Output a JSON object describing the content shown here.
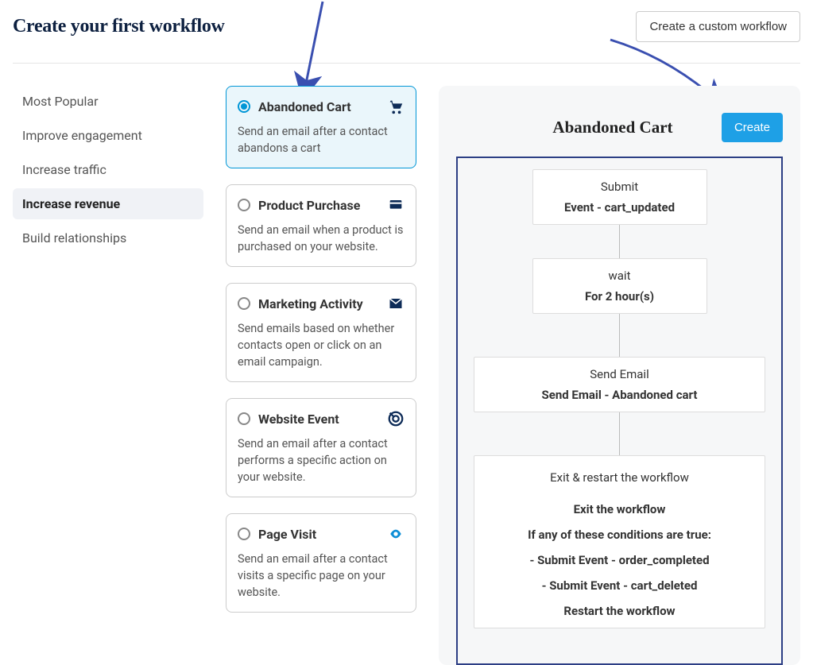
{
  "header": {
    "title": "Create your first workflow",
    "custom_button": "Create a custom workflow"
  },
  "sidebar": {
    "items": [
      {
        "label": "Most Popular",
        "active": false
      },
      {
        "label": "Improve engagement",
        "active": false
      },
      {
        "label": "Increase traffic",
        "active": false
      },
      {
        "label": "Increase revenue",
        "active": true
      },
      {
        "label": "Build relationships",
        "active": false
      }
    ]
  },
  "options": [
    {
      "title": "Abandoned Cart",
      "desc": "Send an email after a contact abandons a cart",
      "icon": "cart-icon",
      "selected": true
    },
    {
      "title": "Product Purchase",
      "desc": "Send an email when a product is purchased on your website.",
      "icon": "card-icon",
      "selected": false
    },
    {
      "title": "Marketing Activity",
      "desc": "Send emails based on whether contacts open or click on an email campaign.",
      "icon": "envelope-icon",
      "selected": false
    },
    {
      "title": "Website Event",
      "desc": "Send an email after a contact performs a specific action on your website.",
      "icon": "target-icon",
      "selected": false
    },
    {
      "title": "Page Visit",
      "desc": "Send an email after a contact visits a specific page on your website.",
      "icon": "eye-icon",
      "selected": false
    }
  ],
  "panel": {
    "title": "Abandoned Cart",
    "create_button": "Create",
    "nodes": {
      "submit": {
        "title": "Submit",
        "sub": "Event - cart_updated"
      },
      "wait": {
        "title": "wait",
        "sub": "For 2 hour(s)"
      },
      "send": {
        "title": "Send Email",
        "sub": "Send Email - Abandoned cart"
      },
      "exit": {
        "title": "Exit & restart the workflow",
        "lines": [
          "Exit the workflow",
          "If any of these conditions are true:",
          "- Submit Event - order_completed",
          "- Submit Event - cart_deleted",
          "Restart the workflow"
        ]
      }
    }
  }
}
